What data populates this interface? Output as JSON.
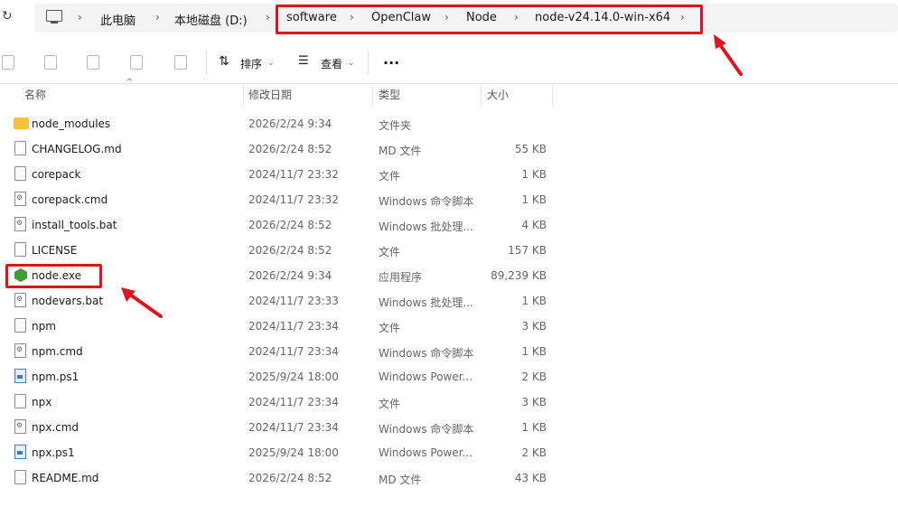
{
  "address_bar": {
    "crumbs": [
      "此电脑",
      "本地磁盘 (D:)",
      "software",
      "OpenClaw",
      "Node",
      "node-v24.14.0-win-x64"
    ]
  },
  "toolbar": {
    "sort_label": "排序",
    "view_label": "查看",
    "more_label": "..."
  },
  "columns": {
    "name": "名称",
    "date": "修改日期",
    "type": "类型",
    "size": "大小"
  },
  "files": [
    {
      "name": "node_modules",
      "date": "2026/2/24 9:34",
      "type": "文件夹",
      "size": "",
      "icon": "folder-icon"
    },
    {
      "name": "CHANGELOG.md",
      "date": "2026/2/24 8:52",
      "type": "MD 文件",
      "size": "55 KB",
      "icon": "file-icon"
    },
    {
      "name": "corepack",
      "date": "2024/11/7 23:32",
      "type": "文件",
      "size": "1 KB",
      "icon": "file-icon"
    },
    {
      "name": "corepack.cmd",
      "date": "2024/11/7 23:32",
      "type": "Windows 命令脚本",
      "size": "1 KB",
      "icon": "script-icon"
    },
    {
      "name": "install_tools.bat",
      "date": "2026/2/24 8:52",
      "type": "Windows 批处理...",
      "size": "4 KB",
      "icon": "script-icon"
    },
    {
      "name": "LICENSE",
      "date": "2026/2/24 8:52",
      "type": "文件",
      "size": "157 KB",
      "icon": "file-icon"
    },
    {
      "name": "node.exe",
      "date": "2026/2/24 9:34",
      "type": "应用程序",
      "size": "89,239 KB",
      "icon": "node-icon"
    },
    {
      "name": "nodevars.bat",
      "date": "2024/11/7 23:33",
      "type": "Windows 批处理...",
      "size": "1 KB",
      "icon": "script-icon"
    },
    {
      "name": "npm",
      "date": "2024/11/7 23:34",
      "type": "文件",
      "size": "3 KB",
      "icon": "file-icon"
    },
    {
      "name": "npm.cmd",
      "date": "2024/11/7 23:34",
      "type": "Windows 命令脚本",
      "size": "1 KB",
      "icon": "script-icon"
    },
    {
      "name": "npm.ps1",
      "date": "2025/9/24 18:00",
      "type": "Windows Power...",
      "size": "2 KB",
      "icon": "powershell-icon"
    },
    {
      "name": "npx",
      "date": "2024/11/7 23:34",
      "type": "文件",
      "size": "3 KB",
      "icon": "file-icon"
    },
    {
      "name": "npx.cmd",
      "date": "2024/11/7 23:34",
      "type": "Windows 命令脚本",
      "size": "1 KB",
      "icon": "script-icon"
    },
    {
      "name": "npx.ps1",
      "date": "2025/9/24 18:00",
      "type": "Windows Power...",
      "size": "2 KB",
      "icon": "powershell-icon"
    },
    {
      "name": "README.md",
      "date": "2026/2/24 8:52",
      "type": "MD 文件",
      "size": "43 KB",
      "icon": "file-icon"
    }
  ],
  "colors": {
    "highlight": "#e0141e",
    "folder": "#f5c33b",
    "node": "#3f9c35"
  }
}
